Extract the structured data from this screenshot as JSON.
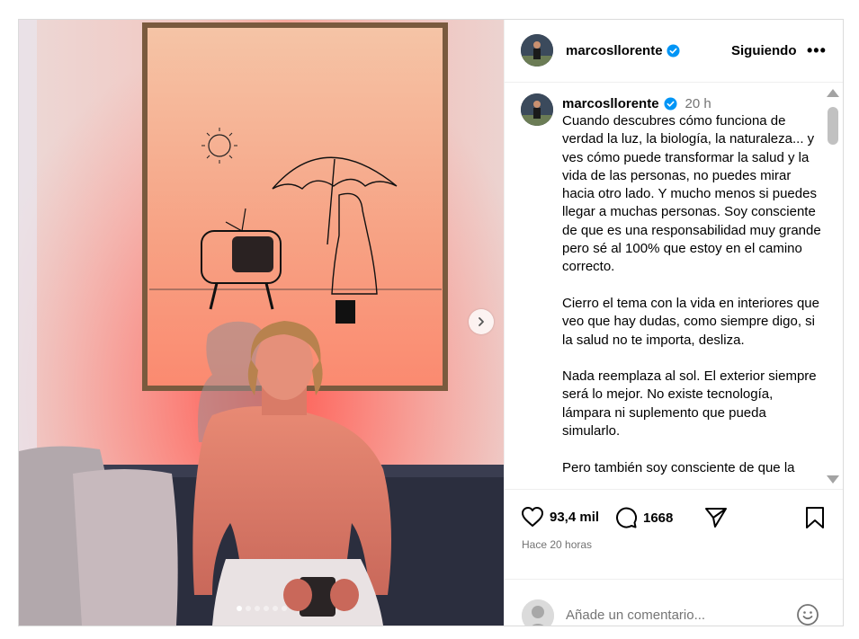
{
  "post": {
    "username": "marcosllorente",
    "follow_label": "Siguiendo",
    "more_label": "•••",
    "time_ago": "20 h",
    "caption": "Cuando descubres cómo funciona de verdad la luz, la biología, la naturaleza... y ves cómo puede transformar la salud y la vida de las personas, no puedes mirar hacia otro lado. Y mucho menos si puedes llegar a muchas personas. Soy consciente de que es una responsabilidad muy grande pero sé al 100% que estoy en el camino correcto.\n\nCierro el tema con la vida en interiores que veo que hay dudas, como siempre digo, si la salud no te importa, desliza.\n\nNada reemplaza al sol. El exterior siempre será lo mejor. No existe tecnología, lámpara ni suplemento que pueda simularlo.\n\nPero también soy consciente de que la",
    "likes": "93,4 mil",
    "comments": "1668",
    "timestamp": "Hace 20 horas",
    "comment_placeholder": "Añade un comentario...",
    "carousel": {
      "total": 6,
      "active_index": 0
    }
  },
  "icons": {
    "verified": "verified-badge-icon",
    "like": "heart-icon",
    "comment": "comment-bubble-icon",
    "share": "paper-plane-icon",
    "save": "bookmark-icon",
    "emoji": "smiley-icon",
    "next": "chevron-right-icon"
  },
  "colors": {
    "verified_blue": "#0095f6",
    "secondary_text": "#737373",
    "border": "#dbdbdb"
  }
}
